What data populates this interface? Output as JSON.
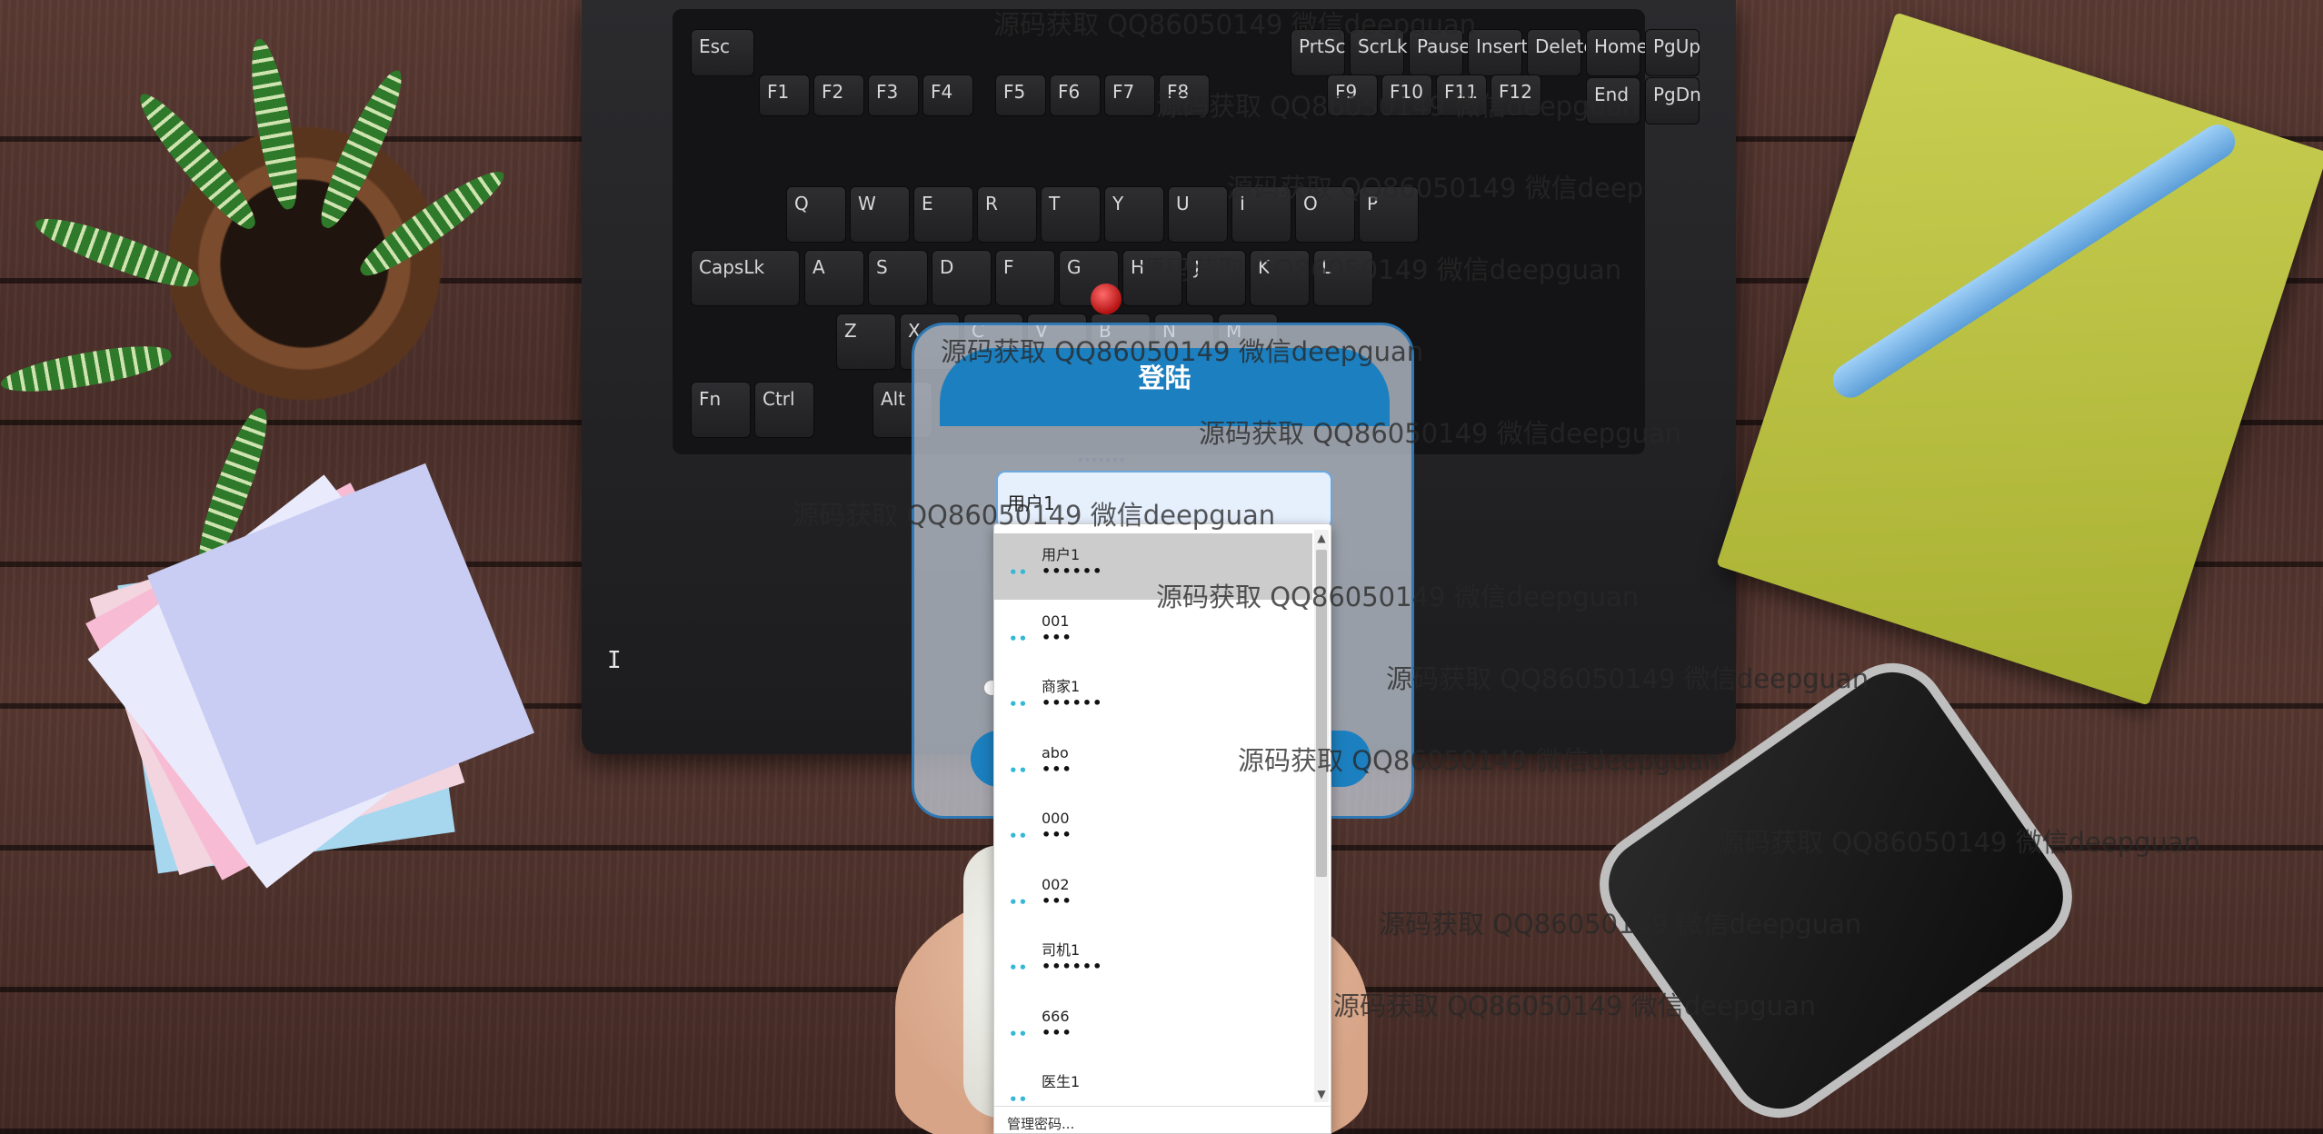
{
  "login": {
    "title": "登陆",
    "username_value": "用户1",
    "header_color": "#1c7fbf",
    "border_color": "#2e79b5"
  },
  "autocomplete": {
    "items": [
      {
        "username": "用户1",
        "password_mask": "••••••",
        "selected": true
      },
      {
        "username": "001",
        "password_mask": "•••",
        "selected": false
      },
      {
        "username": "商家1",
        "password_mask": "••••••",
        "selected": false
      },
      {
        "username": "abo",
        "password_mask": "•••",
        "selected": false
      },
      {
        "username": "000",
        "password_mask": "•••",
        "selected": false
      },
      {
        "username": "002",
        "password_mask": "•••",
        "selected": false
      },
      {
        "username": "司机1",
        "password_mask": "••••••",
        "selected": false
      },
      {
        "username": "666",
        "password_mask": "•••",
        "selected": false
      },
      {
        "username": "医生1",
        "password_mask": "",
        "selected": false
      }
    ],
    "key_icon": "key-icon",
    "footer": "管理密码..."
  },
  "watermark_text": "源码获取 QQ86050149 微信deepguan",
  "keyboard": {
    "keys": [
      "Esc",
      "PrtSc",
      "ScrLk",
      "Pause",
      "Insert",
      "Delete",
      "Home",
      "PgUp",
      "End",
      "PgDn",
      "F1",
      "F2",
      "F3",
      "F4",
      "F5",
      "F6",
      "F7",
      "F8",
      "F9",
      "F10",
      "F11",
      "F12",
      "Q",
      "W",
      "E",
      "R",
      "T",
      "Y",
      "U",
      "I",
      "O",
      "P",
      "A",
      "S",
      "D",
      "F",
      "G",
      "H",
      "J",
      "K",
      "L",
      "Z",
      "X",
      "C",
      "V",
      "B",
      "N",
      "M",
      "CapsLk",
      "Fn",
      "Ctrl",
      "Alt"
    ]
  }
}
